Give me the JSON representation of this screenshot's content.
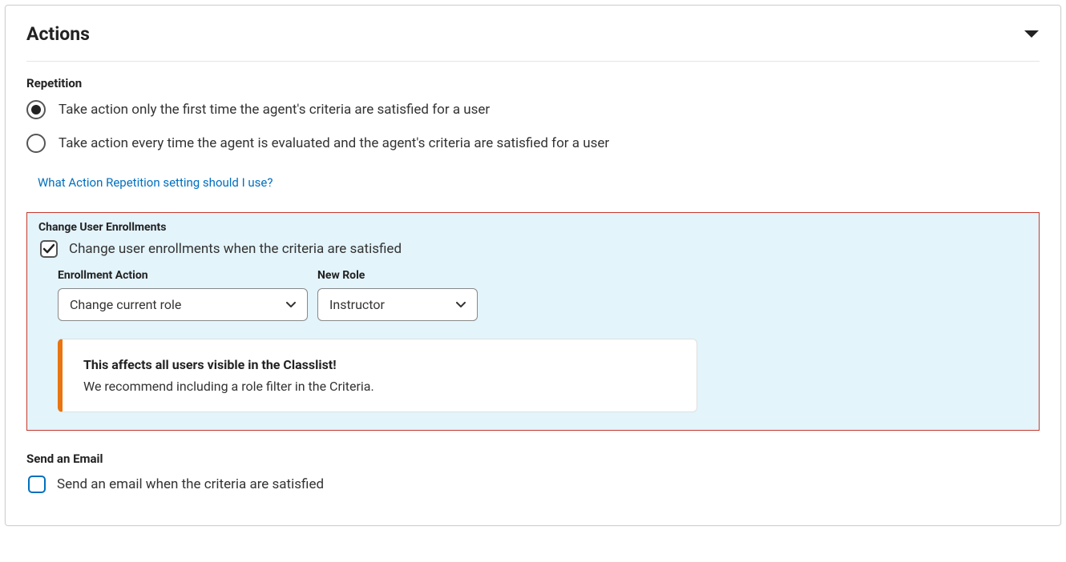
{
  "panel": {
    "title": "Actions"
  },
  "repetition": {
    "label": "Repetition",
    "option1": "Take action only the first time the agent's criteria are satisfied for a user",
    "option2": "Take action every time the agent is evaluated and the agent's criteria are satisfied for a user",
    "help_link": "What Action Repetition setting should I use?"
  },
  "enrollments": {
    "label": "Change User Enrollments",
    "checkbox_label": "Change user enrollments when the criteria are satisfied",
    "action_label": "Enrollment Action",
    "action_value": "Change current role",
    "role_label": "New Role",
    "role_value": "Instructor",
    "alert_title": "This affects all users visible in the Classlist!",
    "alert_body": "We recommend including a role filter in the Criteria."
  },
  "email": {
    "label": "Send an Email",
    "checkbox_label": "Send an email when the criteria are satisfied"
  }
}
